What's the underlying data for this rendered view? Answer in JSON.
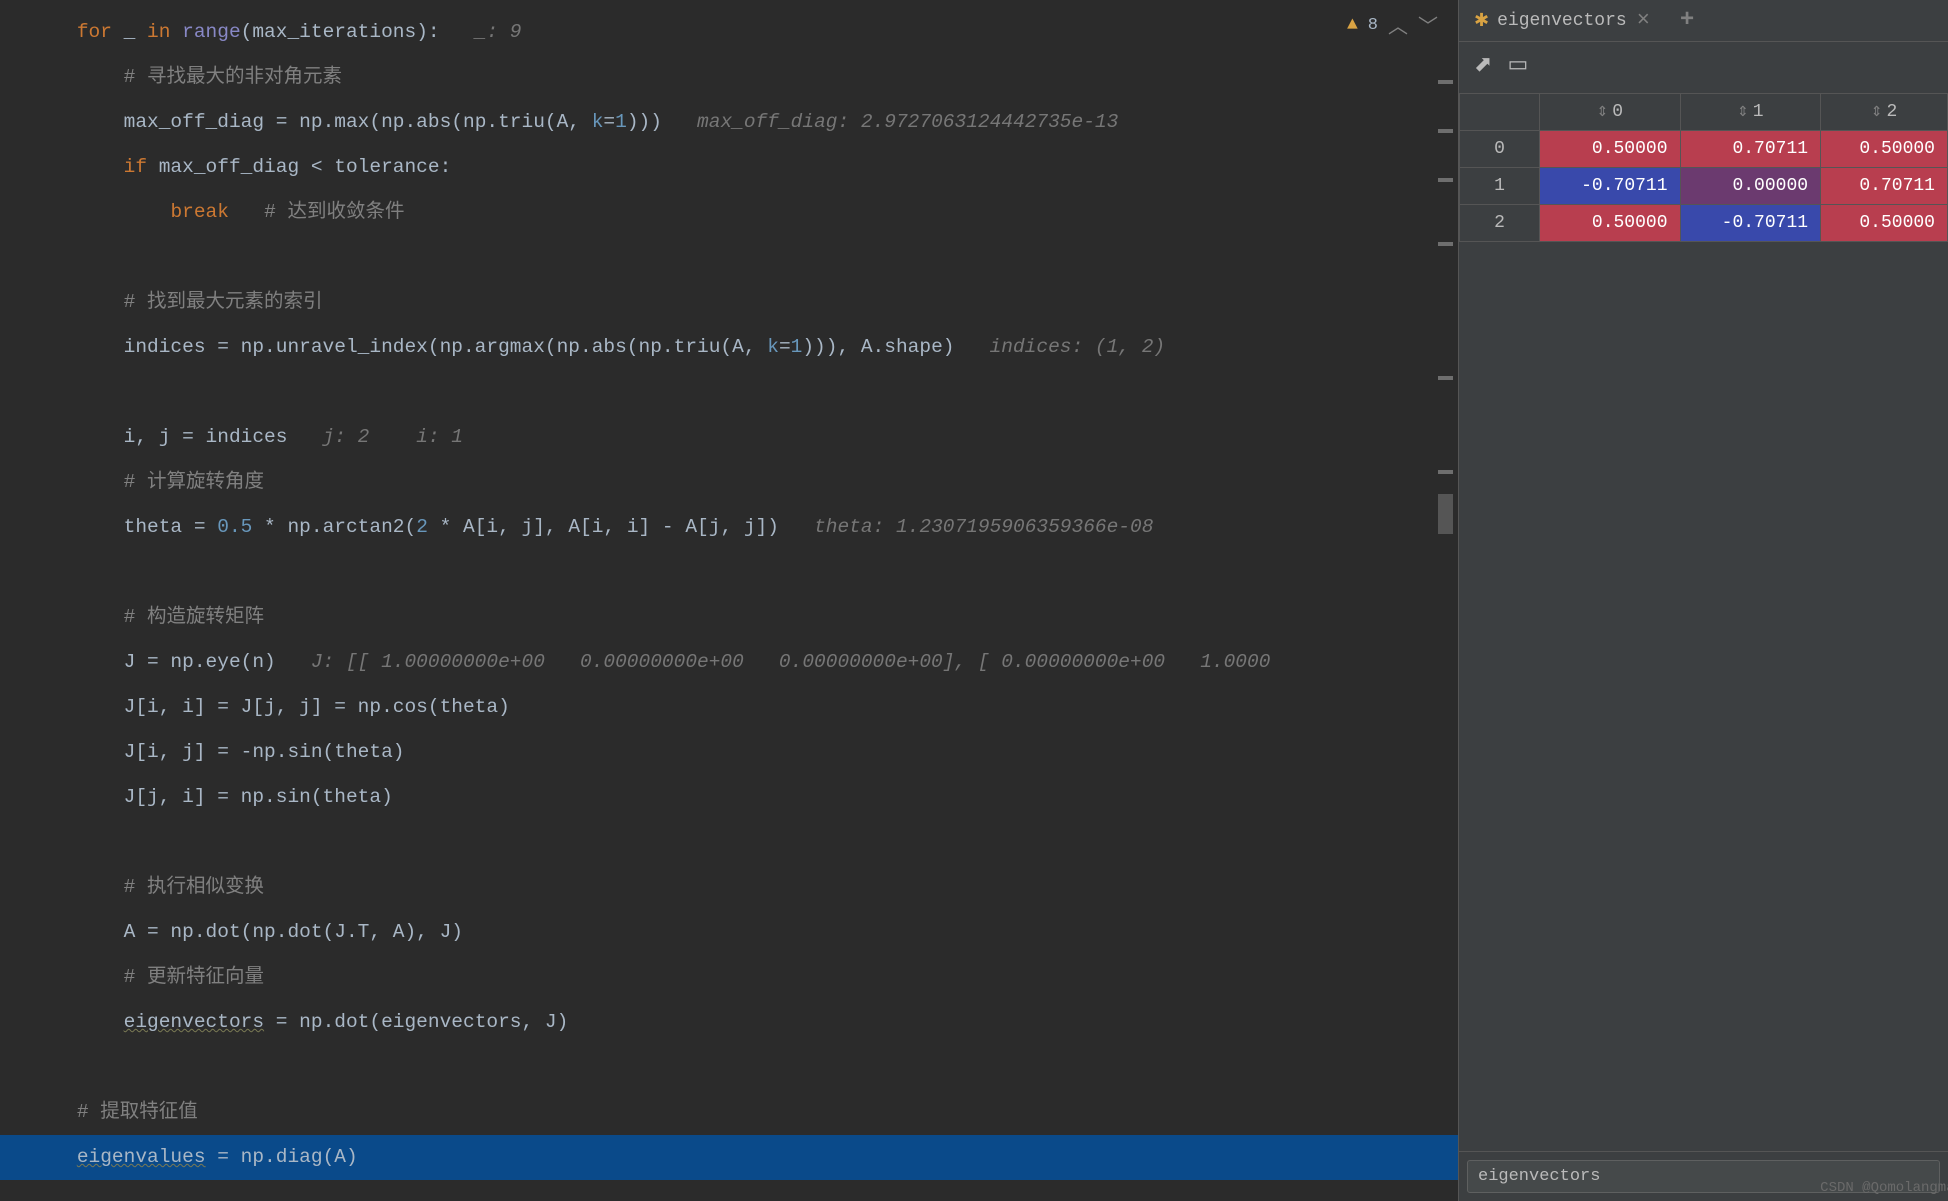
{
  "warnings": {
    "count": "8"
  },
  "code": {
    "line1": {
      "for": "for",
      "underscore": "_",
      "in": "in",
      "range": "range",
      "max_iter": "max_iterations",
      "inlay": "_: 9"
    },
    "line2": {
      "comment": "# 寻找最大的非对角元素"
    },
    "line3": {
      "var": "max_off_diag",
      "eq": " = np.max(np.abs(np.triu(A, ",
      "kparam": "k",
      "kval": "1",
      "close": ")))",
      "inlay": "max_off_diag: 2.9727063124442735e-13"
    },
    "line4": {
      "if": "if",
      "cond": " max_off_diag < tolerance:"
    },
    "line5": {
      "break": "break",
      "comment": "# 达到收敛条件"
    },
    "line6": {
      "comment": "# 找到最大元素的索引"
    },
    "line7": {
      "pre": "indices = np.unravel_index(np.argmax(np.abs(np.triu(A, ",
      "kparam": "k",
      "kval": "1",
      "close": "))), A.shape)",
      "inlay": "indices: (1, 2)"
    },
    "line8": {
      "text": "i, j = indices",
      "inlay1": "j: 2",
      "inlay2": "i: 1"
    },
    "line9": {
      "comment": "# 计算旋转角度"
    },
    "line10": {
      "pre": "theta = ",
      "num1": "0.5",
      "mid": " * np.arctan2(",
      "num2": "2",
      "post": " * A[i, j], A[i, i] - A[j, j])",
      "inlay": "theta: 1.2307195906359366e-08"
    },
    "line11": {
      "comment": "# 构造旋转矩阵"
    },
    "line12": {
      "text": "J = np.eye(n)",
      "inlay": "J: [[ 1.00000000e+00   0.00000000e+00   0.00000000e+00], [ 0.00000000e+00   1.0000"
    },
    "line13": {
      "text": "J[i, i] = J[j, j] = np.cos(theta)"
    },
    "line14": {
      "text": "J[i, j] = -np.sin(theta)"
    },
    "line15": {
      "text": "J[j, i] = np.sin(theta)"
    },
    "line16": {
      "comment": "# 执行相似变换"
    },
    "line17": {
      "text": "A = np.dot(np.dot(J.T, A), J)"
    },
    "line18": {
      "comment": "# 更新特征向量"
    },
    "line19": {
      "pre": "eigenvectors",
      "post": " = np.dot(eigenvectors, J)"
    },
    "line20": {
      "comment": "# 提取特征值"
    },
    "line21": {
      "pre": "eigenvalues",
      "post": " = np.diag(A)"
    }
  },
  "panel": {
    "tab_title": "eigenvectors",
    "input_value": "eigenvectors"
  },
  "chart_data": {
    "type": "table",
    "title": "eigenvectors",
    "col_headers": [
      "0",
      "1",
      "2"
    ],
    "row_headers": [
      "0",
      "1",
      "2"
    ],
    "rows": [
      [
        "0.50000",
        "0.70711",
        "0.50000"
      ],
      [
        "-0.70711",
        "0.00000",
        "0.70711"
      ],
      [
        "0.50000",
        "-0.70711",
        "0.50000"
      ]
    ]
  },
  "watermark": "CSDN @QomolangmaH"
}
